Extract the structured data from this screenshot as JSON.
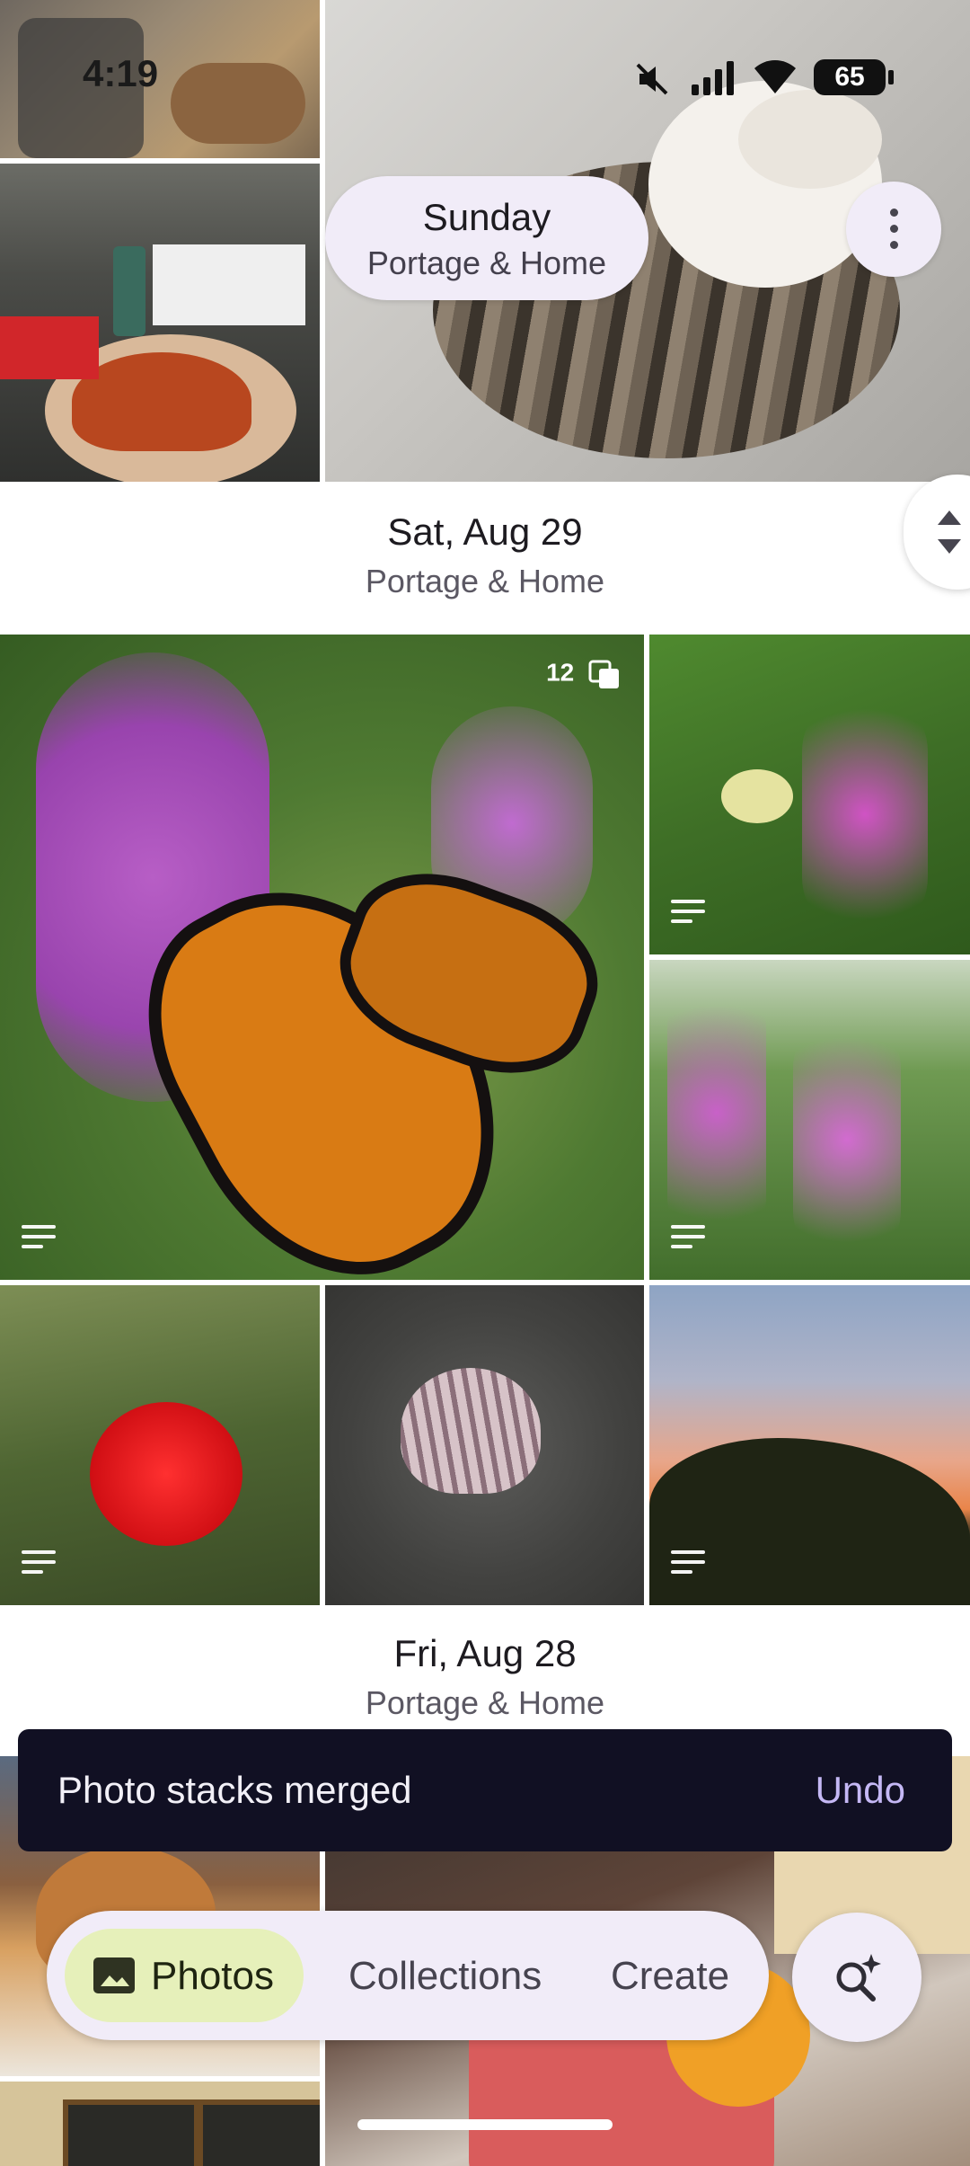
{
  "status_bar": {
    "time": "4:19",
    "battery": "65",
    "icons": [
      "mute-icon",
      "signal-icon",
      "wifi-icon",
      "battery-icon"
    ]
  },
  "floating_date": {
    "day": "Sunday",
    "location": "Portage & Home"
  },
  "sections": [
    {
      "date": "Sat, Aug 29",
      "location": "Portage & Home"
    },
    {
      "date": "Fri, Aug 28",
      "location": "Portage & Home"
    }
  ],
  "stack_badge": {
    "count": "12"
  },
  "snackbar": {
    "message": "Photo stacks merged",
    "action": "Undo"
  },
  "bottom_nav": {
    "items": [
      {
        "label": "Photos",
        "icon": "photo-icon",
        "selected": true
      },
      {
        "label": "Collections",
        "selected": false
      },
      {
        "label": "Create",
        "selected": false
      }
    ],
    "search_icon": "ask-photos-search-icon"
  },
  "colors": {
    "pill_bg": "#f1ecf8",
    "selected_nav_bg": "#e6f0ba",
    "snackbar_bg": "#111023",
    "undo_color": "#c5b8f5"
  }
}
